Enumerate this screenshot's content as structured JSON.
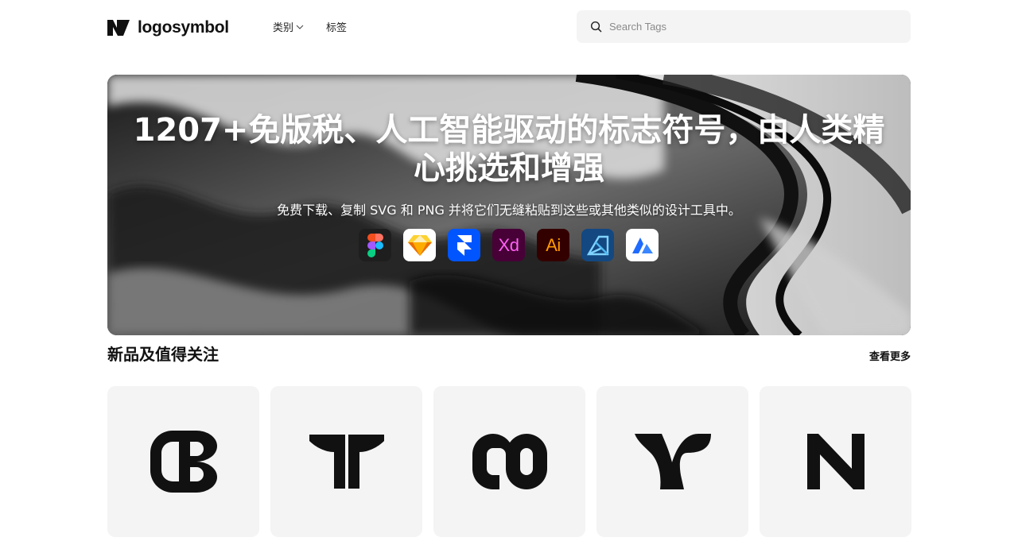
{
  "brand": {
    "name": "logosymbol"
  },
  "nav": {
    "items": [
      {
        "label": "类别",
        "has_dropdown": true
      },
      {
        "label": "标签",
        "has_dropdown": false
      }
    ]
  },
  "search": {
    "placeholder": "Search Tags",
    "value": ""
  },
  "hero": {
    "title": "1207+免版税、人工智能驱动的标志符号，由人类精心挑选和增强",
    "subtitle": "免费下载、复制 SVG 和 PNG 并将它们无缝粘贴到这些或其他类似的设计工具中。",
    "tools": [
      {
        "icon": "figma-icon"
      },
      {
        "icon": "sketch-icon"
      },
      {
        "icon": "framer-icon"
      },
      {
        "icon": "adobe-xd-icon"
      },
      {
        "icon": "adobe-illustrator-icon"
      },
      {
        "icon": "affinity-designer-icon"
      },
      {
        "icon": "lunacy-icon"
      }
    ]
  },
  "section": {
    "title": "新品及值得关注",
    "see_more": "查看更多"
  },
  "logos": [
    {
      "icon": "cb-monogram-logo"
    },
    {
      "icon": "tt-monogram-logo"
    },
    {
      "icon": "co-loop-logo"
    },
    {
      "icon": "y-branch-logo"
    },
    {
      "icon": "n-monogram-logo"
    }
  ],
  "colors": {
    "accent_text": "#111111",
    "search_bg": "#f4f4f4",
    "card_bg": "#f4f4f4",
    "xd": "#ff61f6",
    "ai": "#ff9a00",
    "framer": "#0055ff",
    "affinity": "#1b72be"
  }
}
